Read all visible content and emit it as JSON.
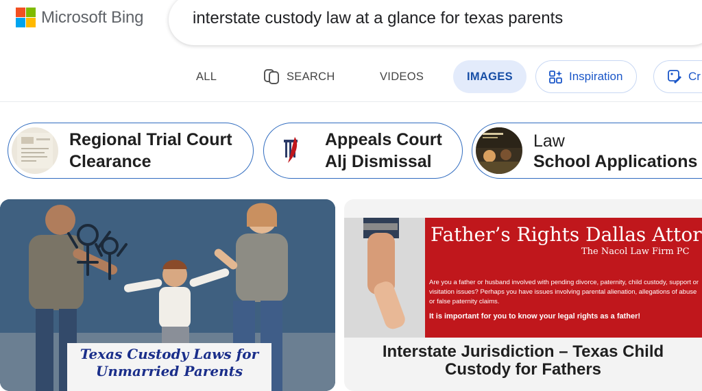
{
  "app": {
    "logo_text": "Microsoft Bing",
    "logo_colors": [
      "#f25022",
      "#7fba00",
      "#00a4ef",
      "#ffb900"
    ]
  },
  "search": {
    "query": "interstate custody law at a glance for texas parents"
  },
  "tabs": [
    {
      "label": "ALL",
      "active": false
    },
    {
      "label": "SEARCH",
      "icon": "copilot-icon",
      "active": false
    },
    {
      "label": "VIDEOS",
      "active": false
    },
    {
      "label": "IMAGES",
      "active": true
    },
    {
      "label": "Inspiration",
      "icon": "inspiration-icon"
    },
    {
      "label": "Cr",
      "icon": "create-icon"
    }
  ],
  "related": [
    {
      "line1": "Regional Trial Court",
      "line2": "Clearance",
      "thumb": "document-thumbnail"
    },
    {
      "line1": "Appeals Court",
      "line2": "Alj Dismissal",
      "thumb": "pillar-logo-thumbnail"
    },
    {
      "line1": "Law",
      "line2": "School Applications I",
      "thumb": "classroom-thumbnail"
    }
  ],
  "results": [
    {
      "caption_line1": "Texas Custody Laws for",
      "caption_line2": "Unmarried Parents"
    },
    {
      "banner_title": "Father’s Rights Dallas Attorne",
      "banner_firm": "The Nacol Law Firm PC",
      "banner_body": "Are you a father or husband involved with pending divorce, paternity, child custody, support or visitation issues? Perhaps you have issues involving parental alienation, allegations of abuse or false paternity claims.",
      "banner_callout": "It is important for you to know your legal rights as a father!",
      "caption_line1": "Interstate Jurisdiction – Texas Child",
      "caption_line2": "Custody for Fathers"
    }
  ],
  "colors": {
    "accent": "#174ea6",
    "active_tab_bg": "#e3ebfb",
    "chip_border": "#2f6bbf",
    "banner_red": "#c0171c"
  }
}
